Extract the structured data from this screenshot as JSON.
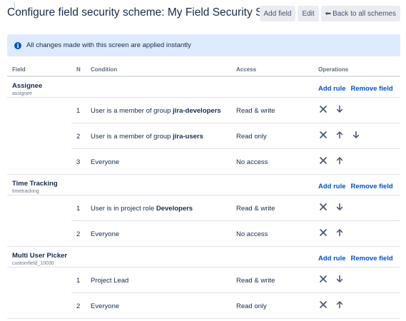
{
  "header": {
    "title": "Configure field security scheme: My Field Security Scheme",
    "add_field": "Add field",
    "edit": "Edit",
    "back": "Back to all schemes"
  },
  "banner": {
    "text": "All changes made with this screen are applied instantly",
    "icon": "info-icon"
  },
  "columns": {
    "field": "Field",
    "n": "N",
    "condition": "Condition",
    "access": "Access",
    "operations": "Operations"
  },
  "fields": [
    {
      "name": "Assignee",
      "key": "assignee",
      "add_rule": "Add rule",
      "remove_field": "Remove field",
      "rules": [
        {
          "n": "1",
          "cond_prefix": "User is a member of group ",
          "cond_bold": "jira-developers",
          "access": "Read & write",
          "ops": [
            "close-icon",
            "arrow-down-icon"
          ]
        },
        {
          "n": "2",
          "cond_prefix": "User is a member of group ",
          "cond_bold": "jira-users",
          "access": "Read only",
          "ops": [
            "close-icon",
            "arrow-up-icon",
            "arrow-down-icon"
          ]
        },
        {
          "n": "3",
          "cond_prefix": "Everyone",
          "cond_bold": "",
          "access": "No access",
          "ops": [
            "close-icon",
            "arrow-up-icon"
          ]
        }
      ]
    },
    {
      "name": "Time Tracking",
      "key": "timetracking",
      "add_rule": "Add rule",
      "remove_field": "Remove field",
      "rules": [
        {
          "n": "1",
          "cond_prefix": "User is in project role ",
          "cond_bold": "Developers",
          "access": "Read & write",
          "ops": [
            "close-icon",
            "arrow-down-icon"
          ]
        },
        {
          "n": "2",
          "cond_prefix": "Everyone",
          "cond_bold": "",
          "access": "No access",
          "ops": [
            "close-icon",
            "arrow-up-icon"
          ]
        }
      ]
    },
    {
      "name": "Multi User Picker",
      "key": "customfield_10030",
      "add_rule": "Add rule",
      "remove_field": "Remove field",
      "rules": [
        {
          "n": "1",
          "cond_prefix": "Project Lead",
          "cond_bold": "",
          "access": "Read & write",
          "ops": [
            "close-icon",
            "arrow-down-icon"
          ]
        },
        {
          "n": "2",
          "cond_prefix": "Everyone",
          "cond_bold": "",
          "access": "Read only",
          "ops": [
            "close-icon",
            "arrow-up-icon"
          ]
        }
      ]
    }
  ],
  "colors": {
    "link": "#0052cc",
    "banner_bg": "#deebff",
    "button_bg": "#ebecf0",
    "text": "#172b4d"
  }
}
